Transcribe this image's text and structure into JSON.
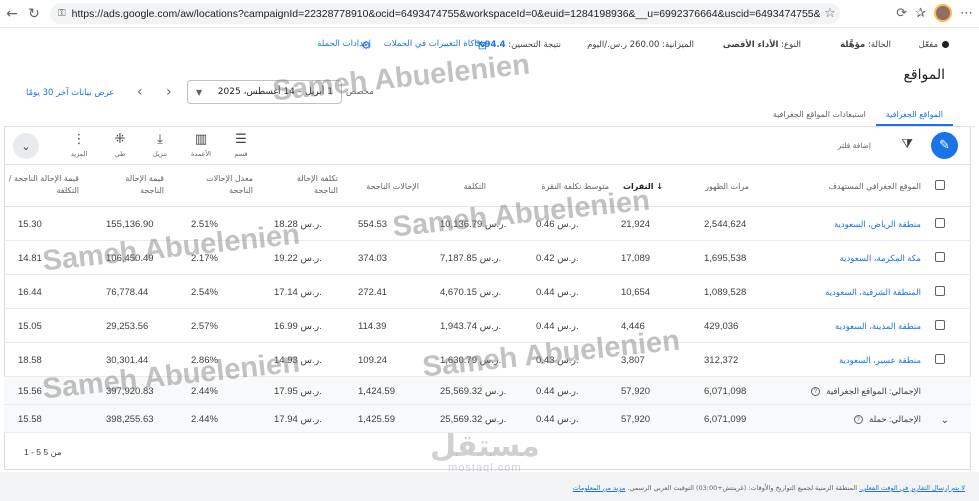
{
  "browser": {
    "url": "https://ads.google.com/aw/locations?campaignId=22328778910&ocid=6493474755&workspaceId=0&euid=1284198936&__u=6992376664&uscid=6493474755&...",
    "back_icon": "arrow-left-icon",
    "reload_icon": "reload-icon"
  },
  "status": {
    "state_label": "مفعّل",
    "status_label": "الحالة:",
    "status_value": "مؤهَّلة",
    "type_label": "النوع:",
    "type_value": "الأداء الأقصى",
    "budget_label": "الميزانية:",
    "budget_value": "260.00 ر.س./اليوم",
    "score_label": "نتيجة التحسين:",
    "score_value": "94.4%",
    "simulate_link": "محاكاة التغييرات في الحملات",
    "settings_link": "إعدادات الحملة"
  },
  "page_title": "المواقع",
  "date": {
    "custom_label": "مخصص",
    "range": "1 أبريل – 14 أغسطس، 2025",
    "last30_link": "عرض بيانات آخر 30 يومًا"
  },
  "tabs": [
    {
      "label": "المواقع الجغرافية",
      "active": true
    },
    {
      "label": "استبعادات المواقع الجغرافية",
      "active": false
    }
  ],
  "toolbar": {
    "add_filter": "إضافة فلتر",
    "tools": [
      {
        "icon": "segment-icon",
        "label": "قسم"
      },
      {
        "icon": "columns-icon",
        "label": "الأعمدة"
      },
      {
        "icon": "download-icon",
        "label": "تنزيل"
      },
      {
        "icon": "expand-icon",
        "label": "طي"
      },
      {
        "icon": "more-icon",
        "label": "المزيد"
      }
    ]
  },
  "table": {
    "headers": {
      "location": "الموقع الجغرافي المستهدف",
      "impressions": "مرات الظهور",
      "clicks": "النقرات",
      "avg_cpc": "متوسط تكلفة النقرة",
      "cost": "التكلفة",
      "conversions": "الإحالات الناجحة",
      "cost_conv": "تكلفة الإحالة الناجحة",
      "conv_rate": "معدل الإحالات الناجحة",
      "conv_value": "قيمة الإحالة الناجحة",
      "value_cost": "قيمة الإحالة الناجحة / التكلفة"
    },
    "rows": [
      {
        "location": "منطقة الرياض، السعودية",
        "impressions": "2,544,624",
        "clicks": "21,924",
        "avg_cpc": "0.46 ر.س.",
        "cost": "10,136.79 ر.س.",
        "conversions": "554.53",
        "cost_conv": "18.28 ر.س.",
        "conv_rate": "2.51%",
        "conv_value": "155,136.90",
        "value_cost": "15.30"
      },
      {
        "location": "مكة المكرمة، السعودية",
        "impressions": "1,695,538",
        "clicks": "17,089",
        "avg_cpc": "0.42 ر.س.",
        "cost": "7,187.85 ر.س.",
        "conversions": "374.03",
        "cost_conv": "19.22 ر.س.",
        "conv_rate": "2.17%",
        "conv_value": "106,450.49",
        "value_cost": "14.81"
      },
      {
        "location": "المنطقة الشرقية، السعودية",
        "impressions": "1,089,528",
        "clicks": "10,654",
        "avg_cpc": "0.44 ر.س.",
        "cost": "4,670.15 ر.س.",
        "conversions": "272.41",
        "cost_conv": "17.14 ر.س.",
        "conv_rate": "2.54%",
        "conv_value": "76,778.44",
        "value_cost": "16.44"
      },
      {
        "location": "منطقة المدينة، السعودية",
        "impressions": "429,036",
        "clicks": "4,446",
        "avg_cpc": "0.44 ر.س.",
        "cost": "1,943.74 ر.س.",
        "conversions": "114.39",
        "cost_conv": "16.99 ر.س.",
        "conv_rate": "2.57%",
        "conv_value": "29,253.56",
        "value_cost": "15.05"
      },
      {
        "location": "منطقة عسير، السعودية",
        "impressions": "312,372",
        "clicks": "3,807",
        "avg_cpc": "0.43 ر.س.",
        "cost": "1,630.79 ر.س.",
        "conversions": "109.24",
        "cost_conv": "14.93 ر.س.",
        "conv_rate": "2.86%",
        "conv_value": "30,301.44",
        "value_cost": "18.58"
      }
    ],
    "totals": [
      {
        "location": "الإجمالي: المواقع الجغرافية",
        "impressions": "6,071,098",
        "clicks": "57,920",
        "avg_cpc": "0.44 ر.س.",
        "cost": "25,569.32 ر.س.",
        "conversions": "1,424.59",
        "cost_conv": "17.95 ر.س.",
        "conv_rate": "2.44%",
        "conv_value": "397,920.83",
        "value_cost": "15.56"
      },
      {
        "location": "الإجمالي: حملة",
        "impressions": "6,071,099",
        "clicks": "57,920",
        "avg_cpc": "0.44 ر.س.",
        "cost": "25,569.32 ر.س.",
        "conversions": "1,425.59",
        "cost_conv": "17.94 ر.س.",
        "conv_rate": "2.44%",
        "conv_value": "398,255.63",
        "value_cost": "15.58"
      }
    ],
    "pager": "1 - 5 من 5"
  },
  "footer": {
    "report_link": "لا يتم إرسال التقارير في الوقت الفعلي.",
    "timezone_text": "المنطقة الزمنية لجميع التواريخ والأوقات: (غرينتش+03:00) التوقيت العربي الرسمي.",
    "more_link": "مزيد من المعلومات"
  },
  "watermarks": {
    "text": "Sameh Abuelenien",
    "brand_ar": "مستقل",
    "brand_en": "mostaql.com"
  }
}
